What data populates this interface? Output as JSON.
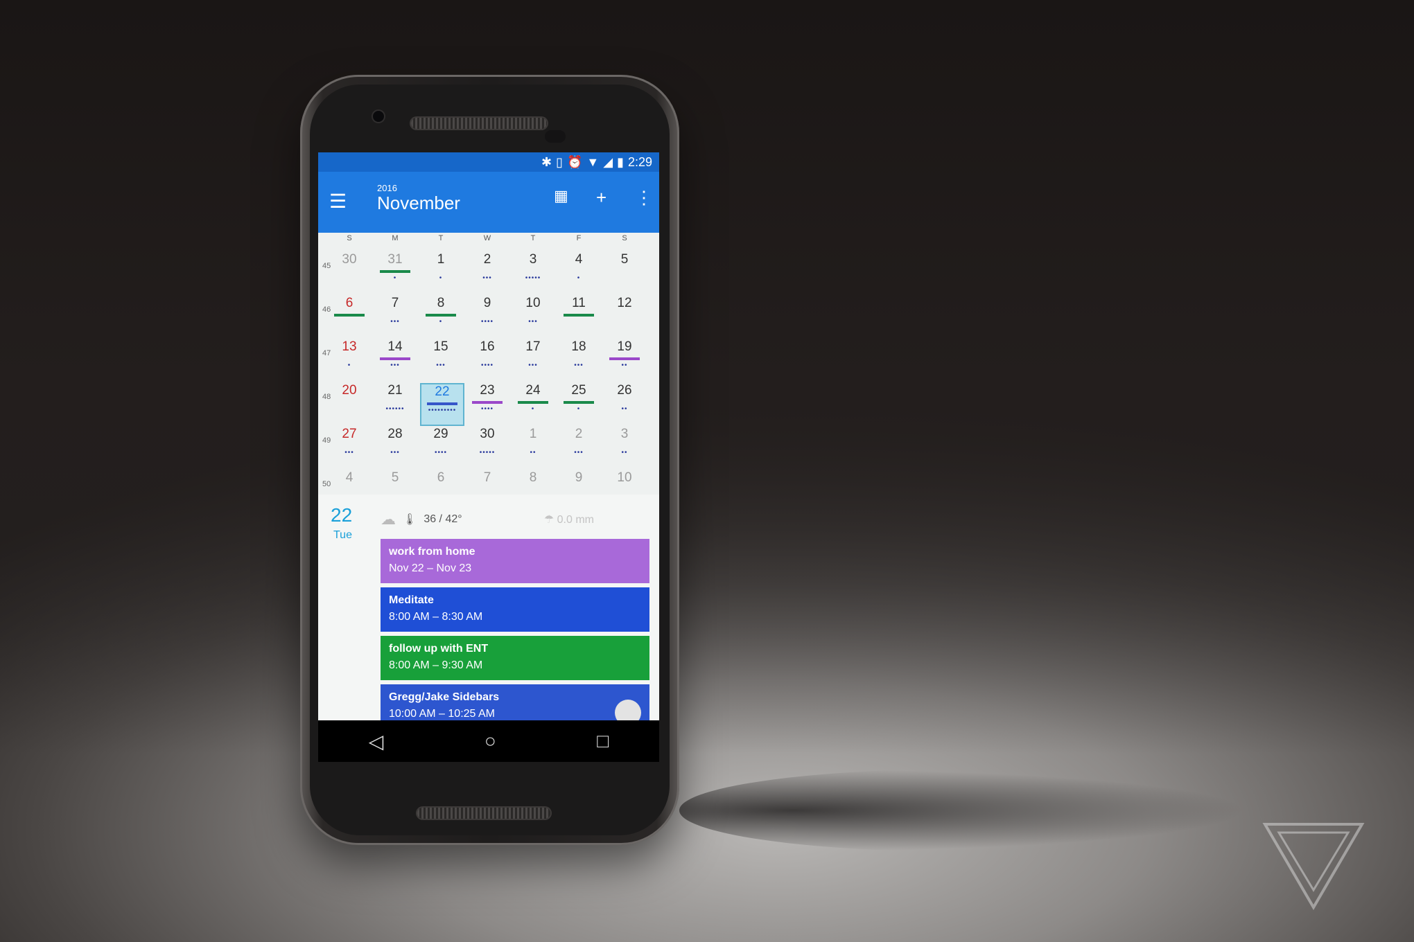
{
  "status": {
    "time": "2:29",
    "icons": [
      "bluetooth-icon",
      "vibrate-icon",
      "alarm-icon",
      "wifi-icon",
      "lte-icon",
      "battery-icon"
    ]
  },
  "header": {
    "year": "2016",
    "month": "November"
  },
  "weekdays": [
    "S",
    "M",
    "T",
    "W",
    "T",
    "F",
    "S"
  ],
  "weeks": [
    "45",
    "46",
    "47",
    "48",
    "49",
    "50"
  ],
  "grid": [
    [
      "30",
      "31",
      "1",
      "2",
      "3",
      "4",
      "5"
    ],
    [
      "6",
      "7",
      "8",
      "9",
      "10",
      "11",
      "12"
    ],
    [
      "13",
      "14",
      "15",
      "16",
      "17",
      "18",
      "19"
    ],
    [
      "20",
      "21",
      "22",
      "23",
      "24",
      "25",
      "26"
    ],
    [
      "27",
      "28",
      "29",
      "30",
      "1",
      "2",
      "3"
    ],
    [
      "4",
      "5",
      "6",
      "7",
      "8",
      "9",
      "10"
    ]
  ],
  "agenda": {
    "day": "22",
    "dow": "Tue",
    "temperature": "36 / 42°",
    "rain": "0.0 mm",
    "events": [
      {
        "title": "work from home",
        "time": "Nov 22 – Nov 23",
        "color": "#a869d9"
      },
      {
        "title": "Meditate",
        "time": "8:00 AM – 8:30 AM",
        "color": "#1f4fd6"
      },
      {
        "title": "follow up with ENT",
        "time": "8:00 AM – 9:30 AM",
        "color": "#18a03a"
      },
      {
        "title": "Gregg/Jake Sidebars",
        "time": "10:00 AM – 10:25 AM",
        "color": "#2d56cf"
      }
    ]
  },
  "colors": {
    "appbar": "#1f7ae0",
    "statusbar": "#1667c9",
    "today": "#1aa0d9"
  }
}
